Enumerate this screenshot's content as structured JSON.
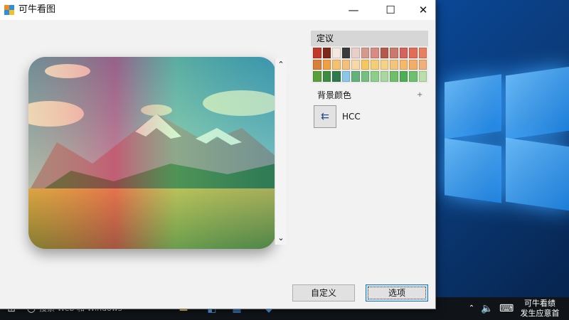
{
  "window": {
    "title": "可牛看图",
    "minimize": "—",
    "maximize": "☐",
    "close": "✕"
  },
  "panel": {
    "header": "定议",
    "palette": [
      "#c0392b",
      "#7b2a1a",
      "#f4e9e0",
      "#3a3a3a",
      "#e8d0c8",
      "#d69a8d",
      "#d88b83",
      "#b55a4b",
      "#c97a6c",
      "#d4645a",
      "#e26c58",
      "#e88060",
      "#d68039",
      "#f0a040",
      "#f5c070",
      "#f2c07a",
      "#f7d8a6",
      "#f6c75f",
      "#f4cd77",
      "#f5d286",
      "#f3c47c",
      "#f6b96b",
      "#f2ad66",
      "#efb07a",
      "#5aa03a",
      "#3c8c42",
      "#2d7a4c",
      "#8cc7e8",
      "#63b27b",
      "#75c080",
      "#8ccf8a",
      "#a8d8a0",
      "#6fbe6a",
      "#4cae55",
      "#6cc070",
      "#b9e0a8"
    ],
    "bg_color_label": "背景颜色",
    "plus": "+",
    "color_icon": "⇇",
    "hex_label": "HCC"
  },
  "buttons": {
    "customize": "自定义",
    "options": "选项"
  },
  "taskbar": {
    "search_text": "搜索 Web 和 Windows",
    "clock_line1": "可牛看绩",
    "clock_line2": "发生应意首"
  },
  "colors": {
    "accent": "#0078d7"
  }
}
